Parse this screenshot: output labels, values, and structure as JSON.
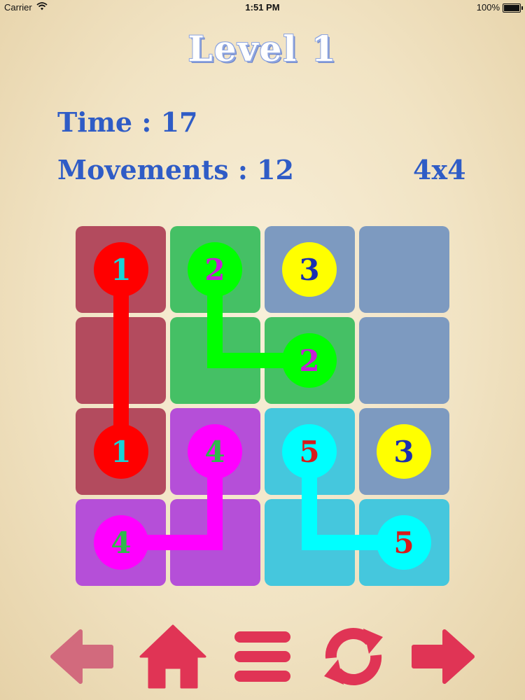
{
  "status_bar": {
    "carrier": "Carrier",
    "time": "1:51 PM",
    "battery": "100%"
  },
  "level_title": "Level 1",
  "time_stat": "Time : 17",
  "moves_stat": "Movements : 12",
  "grid_size": "4x4",
  "colors": {
    "red": "#ff0000",
    "green": "#00ff00",
    "yellow": "#ffff00",
    "magenta": "#ff00ff",
    "cyan": "#00ffff",
    "tile_red": "#b34b5e",
    "tile_green": "#45c065",
    "tile_blue": "#7d9ac0",
    "tile_purple": "#b54fd8",
    "tile_cyan": "#45c7dd",
    "toolbar": "#e03455",
    "toolbar_faded": "#d26a7d"
  },
  "dots": [
    {
      "label": "1",
      "color": "red"
    },
    {
      "label": "2",
      "color": "green"
    },
    {
      "label": "3",
      "color": "yellow"
    },
    {
      "label": "2",
      "color": "green"
    },
    {
      "label": "1",
      "color": "red"
    },
    {
      "label": "4",
      "color": "magenta"
    },
    {
      "label": "5",
      "color": "cyan"
    },
    {
      "label": "3",
      "color": "yellow"
    },
    {
      "label": "4",
      "color": "magenta"
    },
    {
      "label": "5",
      "color": "cyan"
    }
  ],
  "toolbar": {
    "back_icon": "arrow-left-icon",
    "home_icon": "home-icon",
    "menu_icon": "menu-icon",
    "restart_icon": "refresh-icon",
    "next_icon": "arrow-right-icon"
  }
}
